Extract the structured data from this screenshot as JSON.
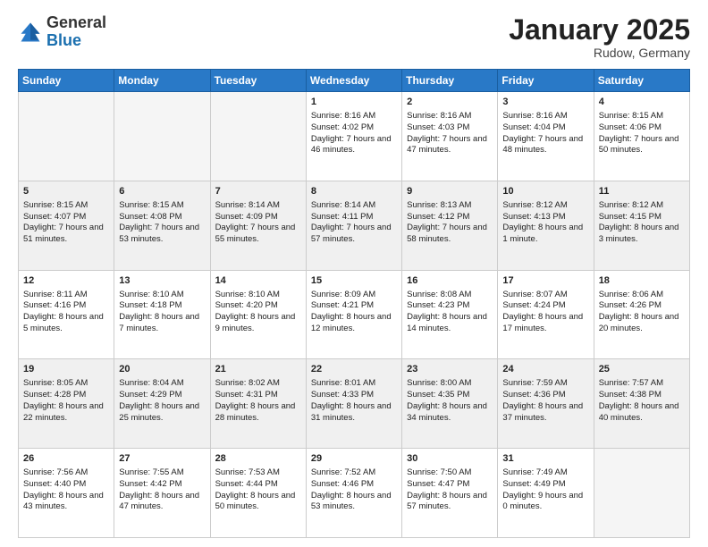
{
  "header": {
    "logo_general": "General",
    "logo_blue": "Blue",
    "month_title": "January 2025",
    "location": "Rudow, Germany"
  },
  "weekdays": [
    "Sunday",
    "Monday",
    "Tuesday",
    "Wednesday",
    "Thursday",
    "Friday",
    "Saturday"
  ],
  "weeks": [
    {
      "shaded": false,
      "days": [
        {
          "number": "",
          "sunrise": "",
          "sunset": "",
          "daylight": "",
          "empty": true
        },
        {
          "number": "",
          "sunrise": "",
          "sunset": "",
          "daylight": "",
          "empty": true
        },
        {
          "number": "",
          "sunrise": "",
          "sunset": "",
          "daylight": "",
          "empty": true
        },
        {
          "number": "1",
          "sunrise": "Sunrise: 8:16 AM",
          "sunset": "Sunset: 4:02 PM",
          "daylight": "Daylight: 7 hours and 46 minutes.",
          "empty": false
        },
        {
          "number": "2",
          "sunrise": "Sunrise: 8:16 AM",
          "sunset": "Sunset: 4:03 PM",
          "daylight": "Daylight: 7 hours and 47 minutes.",
          "empty": false
        },
        {
          "number": "3",
          "sunrise": "Sunrise: 8:16 AM",
          "sunset": "Sunset: 4:04 PM",
          "daylight": "Daylight: 7 hours and 48 minutes.",
          "empty": false
        },
        {
          "number": "4",
          "sunrise": "Sunrise: 8:15 AM",
          "sunset": "Sunset: 4:06 PM",
          "daylight": "Daylight: 7 hours and 50 minutes.",
          "empty": false
        }
      ]
    },
    {
      "shaded": true,
      "days": [
        {
          "number": "5",
          "sunrise": "Sunrise: 8:15 AM",
          "sunset": "Sunset: 4:07 PM",
          "daylight": "Daylight: 7 hours and 51 minutes.",
          "empty": false
        },
        {
          "number": "6",
          "sunrise": "Sunrise: 8:15 AM",
          "sunset": "Sunset: 4:08 PM",
          "daylight": "Daylight: 7 hours and 53 minutes.",
          "empty": false
        },
        {
          "number": "7",
          "sunrise": "Sunrise: 8:14 AM",
          "sunset": "Sunset: 4:09 PM",
          "daylight": "Daylight: 7 hours and 55 minutes.",
          "empty": false
        },
        {
          "number": "8",
          "sunrise": "Sunrise: 8:14 AM",
          "sunset": "Sunset: 4:11 PM",
          "daylight": "Daylight: 7 hours and 57 minutes.",
          "empty": false
        },
        {
          "number": "9",
          "sunrise": "Sunrise: 8:13 AM",
          "sunset": "Sunset: 4:12 PM",
          "daylight": "Daylight: 7 hours and 58 minutes.",
          "empty": false
        },
        {
          "number": "10",
          "sunrise": "Sunrise: 8:12 AM",
          "sunset": "Sunset: 4:13 PM",
          "daylight": "Daylight: 8 hours and 1 minute.",
          "empty": false
        },
        {
          "number": "11",
          "sunrise": "Sunrise: 8:12 AM",
          "sunset": "Sunset: 4:15 PM",
          "daylight": "Daylight: 8 hours and 3 minutes.",
          "empty": false
        }
      ]
    },
    {
      "shaded": false,
      "days": [
        {
          "number": "12",
          "sunrise": "Sunrise: 8:11 AM",
          "sunset": "Sunset: 4:16 PM",
          "daylight": "Daylight: 8 hours and 5 minutes.",
          "empty": false
        },
        {
          "number": "13",
          "sunrise": "Sunrise: 8:10 AM",
          "sunset": "Sunset: 4:18 PM",
          "daylight": "Daylight: 8 hours and 7 minutes.",
          "empty": false
        },
        {
          "number": "14",
          "sunrise": "Sunrise: 8:10 AM",
          "sunset": "Sunset: 4:20 PM",
          "daylight": "Daylight: 8 hours and 9 minutes.",
          "empty": false
        },
        {
          "number": "15",
          "sunrise": "Sunrise: 8:09 AM",
          "sunset": "Sunset: 4:21 PM",
          "daylight": "Daylight: 8 hours and 12 minutes.",
          "empty": false
        },
        {
          "number": "16",
          "sunrise": "Sunrise: 8:08 AM",
          "sunset": "Sunset: 4:23 PM",
          "daylight": "Daylight: 8 hours and 14 minutes.",
          "empty": false
        },
        {
          "number": "17",
          "sunrise": "Sunrise: 8:07 AM",
          "sunset": "Sunset: 4:24 PM",
          "daylight": "Daylight: 8 hours and 17 minutes.",
          "empty": false
        },
        {
          "number": "18",
          "sunrise": "Sunrise: 8:06 AM",
          "sunset": "Sunset: 4:26 PM",
          "daylight": "Daylight: 8 hours and 20 minutes.",
          "empty": false
        }
      ]
    },
    {
      "shaded": true,
      "days": [
        {
          "number": "19",
          "sunrise": "Sunrise: 8:05 AM",
          "sunset": "Sunset: 4:28 PM",
          "daylight": "Daylight: 8 hours and 22 minutes.",
          "empty": false
        },
        {
          "number": "20",
          "sunrise": "Sunrise: 8:04 AM",
          "sunset": "Sunset: 4:29 PM",
          "daylight": "Daylight: 8 hours and 25 minutes.",
          "empty": false
        },
        {
          "number": "21",
          "sunrise": "Sunrise: 8:02 AM",
          "sunset": "Sunset: 4:31 PM",
          "daylight": "Daylight: 8 hours and 28 minutes.",
          "empty": false
        },
        {
          "number": "22",
          "sunrise": "Sunrise: 8:01 AM",
          "sunset": "Sunset: 4:33 PM",
          "daylight": "Daylight: 8 hours and 31 minutes.",
          "empty": false
        },
        {
          "number": "23",
          "sunrise": "Sunrise: 8:00 AM",
          "sunset": "Sunset: 4:35 PM",
          "daylight": "Daylight: 8 hours and 34 minutes.",
          "empty": false
        },
        {
          "number": "24",
          "sunrise": "Sunrise: 7:59 AM",
          "sunset": "Sunset: 4:36 PM",
          "daylight": "Daylight: 8 hours and 37 minutes.",
          "empty": false
        },
        {
          "number": "25",
          "sunrise": "Sunrise: 7:57 AM",
          "sunset": "Sunset: 4:38 PM",
          "daylight": "Daylight: 8 hours and 40 minutes.",
          "empty": false
        }
      ]
    },
    {
      "shaded": false,
      "days": [
        {
          "number": "26",
          "sunrise": "Sunrise: 7:56 AM",
          "sunset": "Sunset: 4:40 PM",
          "daylight": "Daylight: 8 hours and 43 minutes.",
          "empty": false
        },
        {
          "number": "27",
          "sunrise": "Sunrise: 7:55 AM",
          "sunset": "Sunset: 4:42 PM",
          "daylight": "Daylight: 8 hours and 47 minutes.",
          "empty": false
        },
        {
          "number": "28",
          "sunrise": "Sunrise: 7:53 AM",
          "sunset": "Sunset: 4:44 PM",
          "daylight": "Daylight: 8 hours and 50 minutes.",
          "empty": false
        },
        {
          "number": "29",
          "sunrise": "Sunrise: 7:52 AM",
          "sunset": "Sunset: 4:46 PM",
          "daylight": "Daylight: 8 hours and 53 minutes.",
          "empty": false
        },
        {
          "number": "30",
          "sunrise": "Sunrise: 7:50 AM",
          "sunset": "Sunset: 4:47 PM",
          "daylight": "Daylight: 8 hours and 57 minutes.",
          "empty": false
        },
        {
          "number": "31",
          "sunrise": "Sunrise: 7:49 AM",
          "sunset": "Sunset: 4:49 PM",
          "daylight": "Daylight: 9 hours and 0 minutes.",
          "empty": false
        },
        {
          "number": "",
          "sunrise": "",
          "sunset": "",
          "daylight": "",
          "empty": true
        }
      ]
    }
  ]
}
